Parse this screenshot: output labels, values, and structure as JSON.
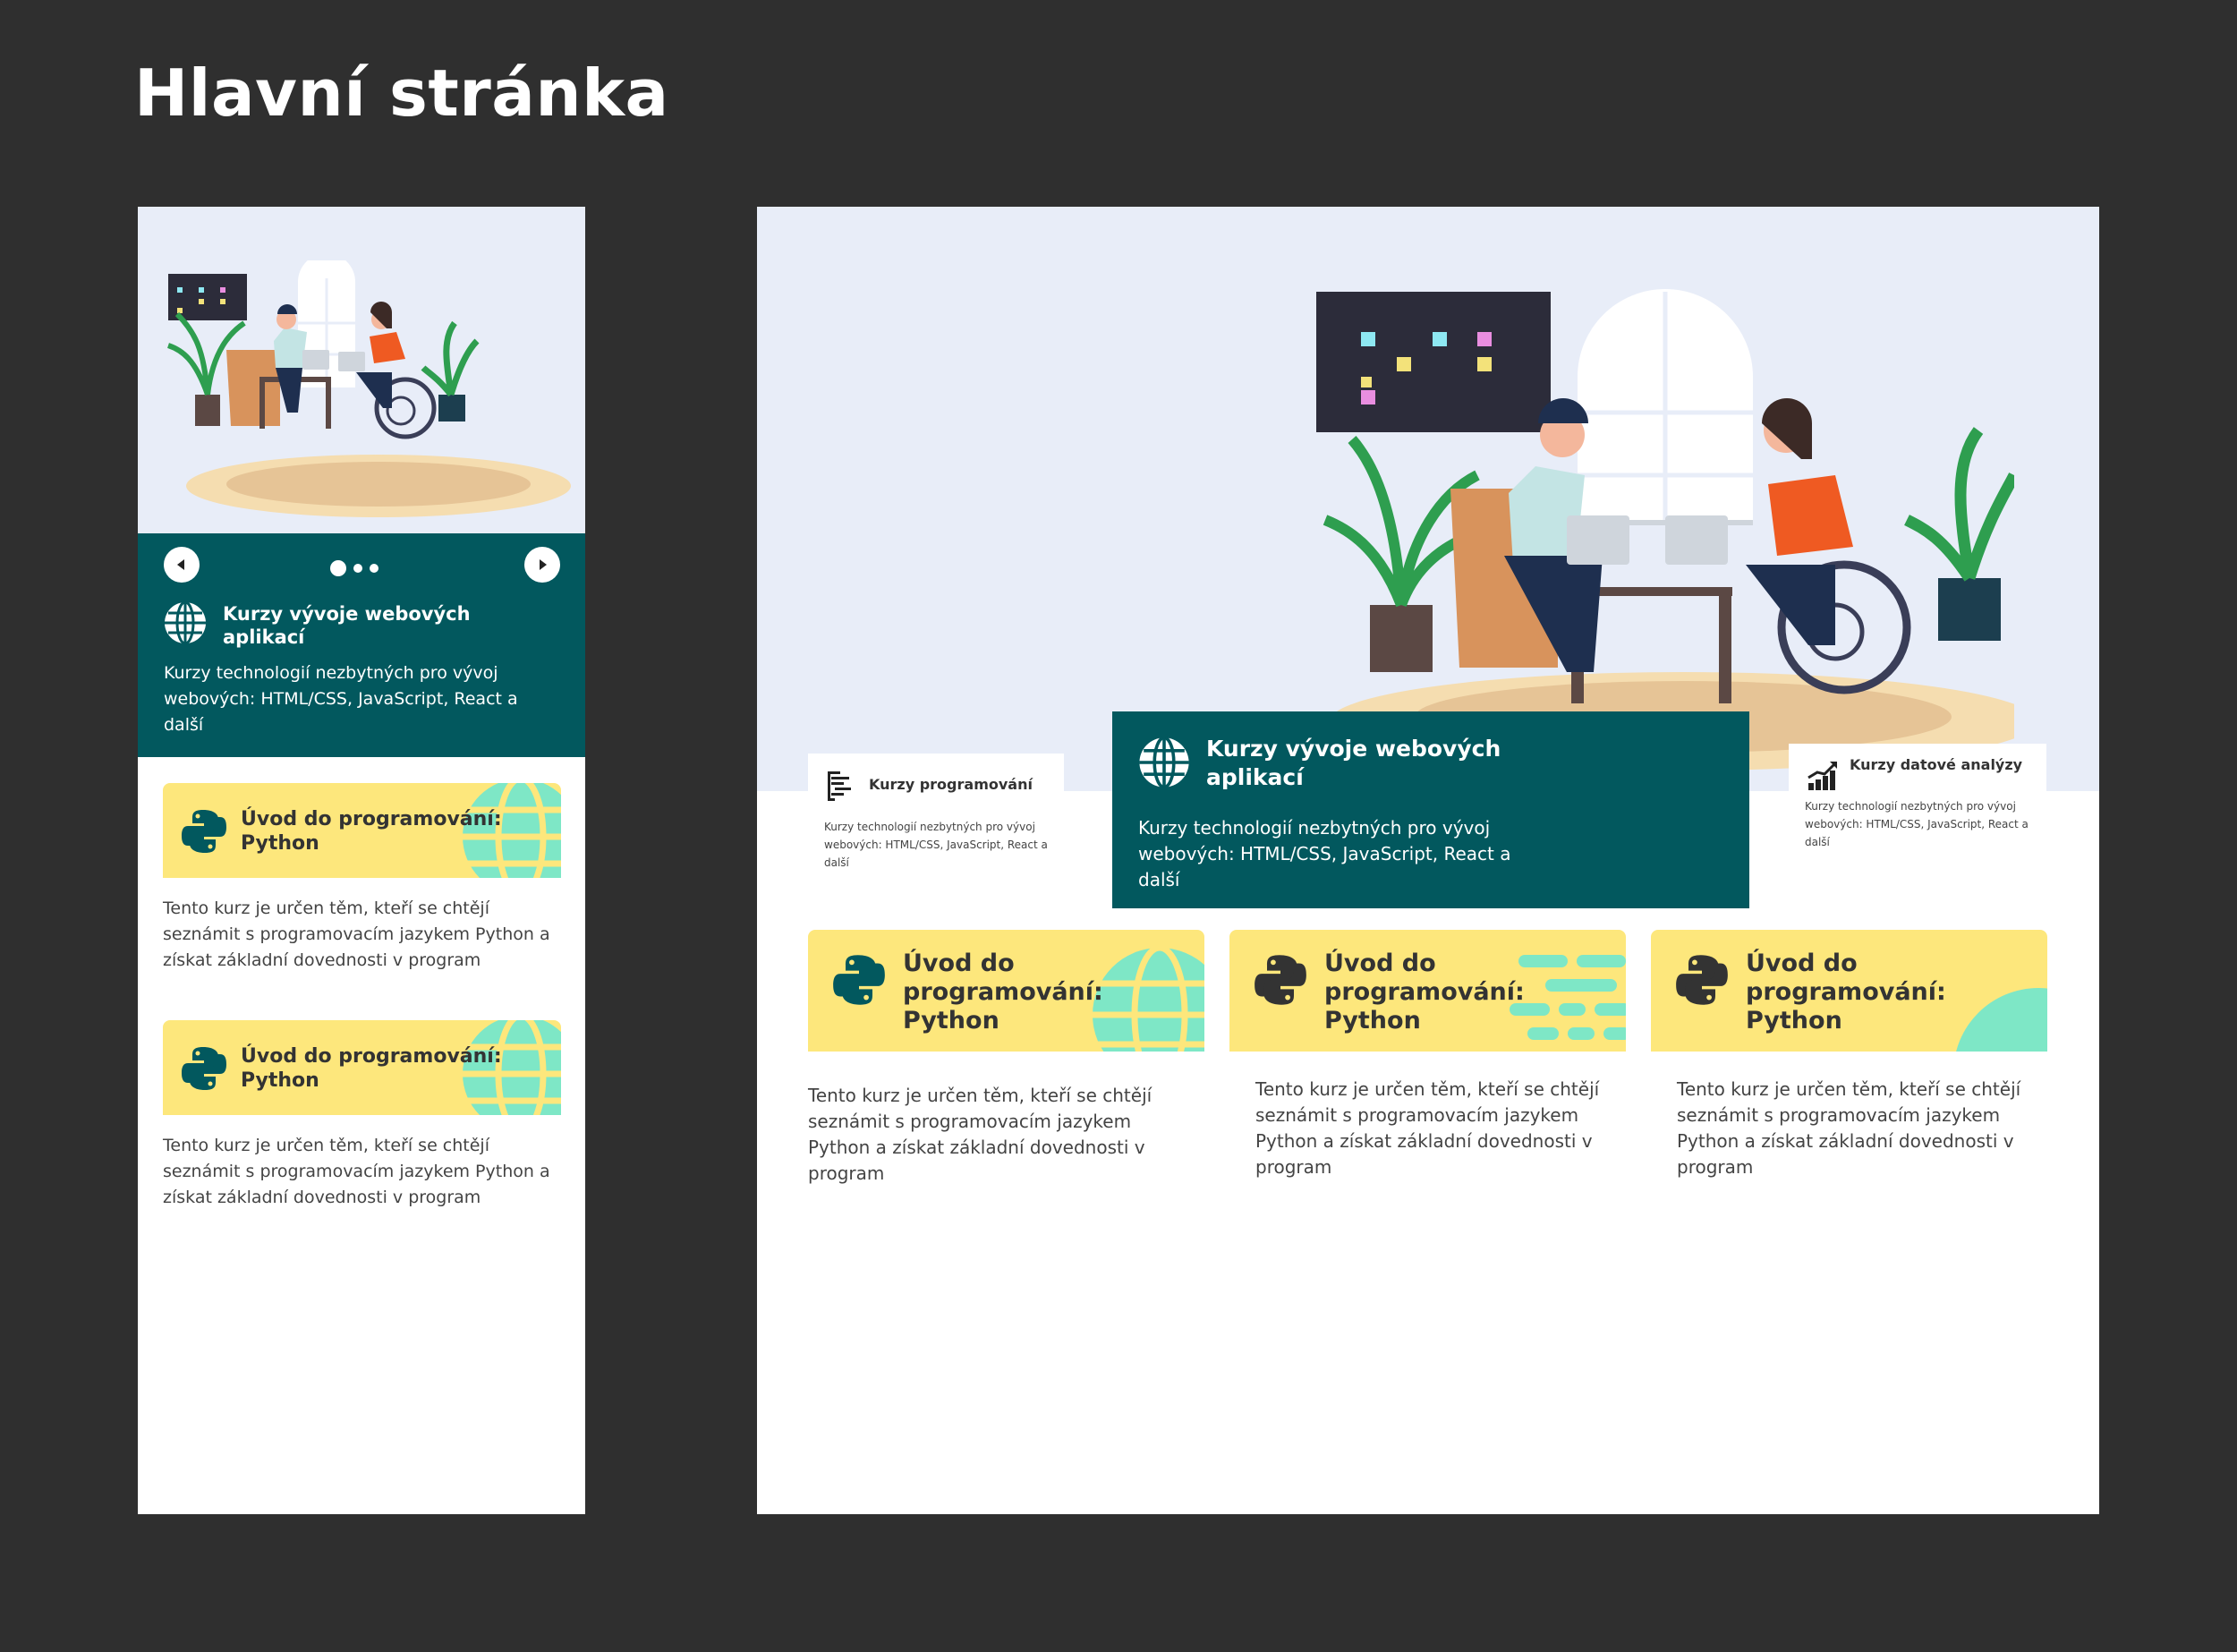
{
  "page": {
    "title": "Hlavní stránka"
  },
  "colors": {
    "background": "#2f2f2f",
    "teal": "#02585e",
    "hero": "#e8edf8",
    "card_yellow": "#fde77c",
    "mint": "#7ee7c6"
  },
  "mobile": {
    "carousel": {
      "prev_icon": "chevron-left-icon",
      "next_icon": "chevron-right-icon",
      "slide_count": 3,
      "active_slide": 1,
      "title": "Kurzy vývoje webových aplikací",
      "description": "Kurzy technologií nezbytných pro vývoj webových: HTML/CSS, JavaScript, React a další",
      "icon": "globe-icon"
    },
    "courses": [
      {
        "title": "Úvod do programování: Python",
        "description": "Tento kurz je určen těm, kteří se chtějí seznámit s programovacím jazykem Python a získat základní dovednosti v program",
        "icon": "python-icon"
      },
      {
        "title": "Úvod do programování: Python",
        "description": "Tento kurz je určen těm, kteří se chtějí seznámit s programovacím jazykem Python a získat základní dovednosti v program",
        "icon": "python-icon"
      }
    ]
  },
  "desktop": {
    "categories": [
      {
        "title": "Kurzy programování",
        "description": "Kurzy technologií nezbytných pro vývoj webových: HTML/CSS, JavaScript, React a další",
        "icon": "code-lines-icon"
      },
      {
        "title": "Kurzy vývoje webových aplikací",
        "description": "Kurzy technologií nezbytných pro vývoj webových: HTML/CSS, JavaScript, React a další",
        "icon": "globe-icon"
      },
      {
        "title": "Kurzy datové analýzy",
        "description": "Kurzy technologií nezbytných pro vývoj webových: HTML/CSS, JavaScript, React a další",
        "icon": "growth-chart-icon"
      }
    ],
    "courses": [
      {
        "title": "Úvod do programování: Python",
        "description": "Tento kurz je určen těm, kteří se chtějí seznámit s programovacím jazykem Python a získat základní dovednosti v program",
        "icon": "python-icon",
        "decoration": "globe"
      },
      {
        "title": "Úvod do programování: Python",
        "description": "Tento kurz je určen těm, kteří se chtějí seznámit s programovacím jazykem Python a získat základní dovednosti v program",
        "icon": "python-icon",
        "decoration": "dashes"
      },
      {
        "title": "Úvod do programování: Python",
        "description": "Tento kurz je určen těm, kteří se chtějí seznámit s programovacím jazykem Python a získat základní dovednosti v program",
        "icon": "python-icon",
        "decoration": "circle"
      }
    ]
  }
}
